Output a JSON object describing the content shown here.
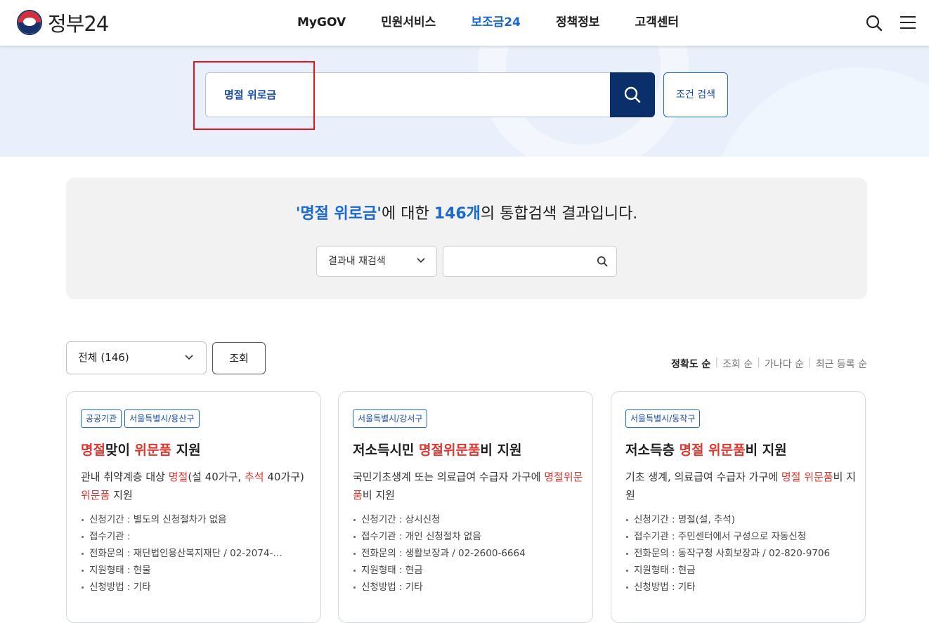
{
  "header": {
    "logo_text": "정부24",
    "nav": [
      "MyGOV",
      "민원서비스",
      "보조금24",
      "정책정보",
      "고객센터"
    ],
    "active_nav": "보조금24"
  },
  "search": {
    "query": "명절 위로금",
    "condition_button": "조건 검색"
  },
  "summary": {
    "query_quoted": "'명절 위로금'",
    "mid": "에 대한 ",
    "count": "146개",
    "tail": "의 통합검색 결과입니다.",
    "research_select": "결과내 재검색",
    "research_input_value": ""
  },
  "filter": {
    "category_select": "전체 (146)",
    "query_button": "조회",
    "sort_options": [
      "정확도 순",
      "조회 순",
      "가나다 순",
      "최근 등록 순"
    ],
    "sort_active": "정확도 순"
  },
  "cards": [
    {
      "tags": [
        "공공기관",
        "서울특별시/용산구"
      ],
      "title_parts": [
        {
          "t": "명절",
          "hl": true
        },
        {
          "t": "맞이 ",
          "hl": false
        },
        {
          "t": "위문품",
          "hl": true
        },
        {
          "t": " 지원",
          "hl": false
        }
      ],
      "desc_parts": [
        {
          "t": "관내 취약계층 대상 ",
          "hl": false
        },
        {
          "t": "명절",
          "hl": true
        },
        {
          "t": "(설 40가구, ",
          "hl": false
        },
        {
          "t": "추석",
          "hl": true
        },
        {
          "t": " 40가구) ",
          "hl": false
        },
        {
          "t": "위문품",
          "hl": true
        },
        {
          "t": " 지원",
          "hl": false
        }
      ],
      "info": [
        "신청기간 : 별도의 신청절차가 없음",
        "접수기관 :",
        "전화문의 : 재단법인용산복지재단 / 02-2074-…",
        "지원형태 : 현물",
        "신청방법 : 기타"
      ]
    },
    {
      "tags": [
        "서울특별시/강서구"
      ],
      "title_parts": [
        {
          "t": "저소득시민 ",
          "hl": false
        },
        {
          "t": "명절위문품",
          "hl": true
        },
        {
          "t": "비 지원",
          "hl": false
        }
      ],
      "desc_parts": [
        {
          "t": "국민기초생계 또는 의료급여 수급자 가구에 ",
          "hl": false
        },
        {
          "t": "명절위문품",
          "hl": true
        },
        {
          "t": "비 지원",
          "hl": false
        }
      ],
      "info": [
        "신청기간 : 상시신청",
        "접수기관 : 개인 신청절차 없음",
        "전화문의 : 생활보장과 / 02-2600-6664",
        "지원형태 : 현금",
        "신청방법 : 기타"
      ]
    },
    {
      "tags": [
        "서울특별시/동작구"
      ],
      "title_parts": [
        {
          "t": "저소득층 ",
          "hl": false
        },
        {
          "t": "명절",
          "hl": true
        },
        {
          "t": " ",
          "hl": false
        },
        {
          "t": "위문품",
          "hl": true
        },
        {
          "t": "비 지원",
          "hl": false
        }
      ],
      "desc_parts": [
        {
          "t": "기초 생계, 의료급여 수급자 가구에 ",
          "hl": false
        },
        {
          "t": "명절",
          "hl": true
        },
        {
          "t": " ",
          "hl": false
        },
        {
          "t": "위문품",
          "hl": true
        },
        {
          "t": "비 지원",
          "hl": false
        }
      ],
      "info": [
        "신청기간 : 명절(설, 추석)",
        "접수기관 : 주민센터에서 구성으로 자동신청",
        "전화문의 : 동작구청 사회보장과 / 02-820-9706",
        "지원형태 : 현금",
        "신청방법 : 기타"
      ]
    }
  ],
  "colors": {
    "brand_blue": "#1a68d1",
    "navy_button": "#0b2f6b",
    "highlight_red": "#e0362f",
    "annotation_red": "#e8141b"
  },
  "icons": [
    "search-icon",
    "menu-icon",
    "chevron-down-icon",
    "logo-taegeuk-icon"
  ]
}
